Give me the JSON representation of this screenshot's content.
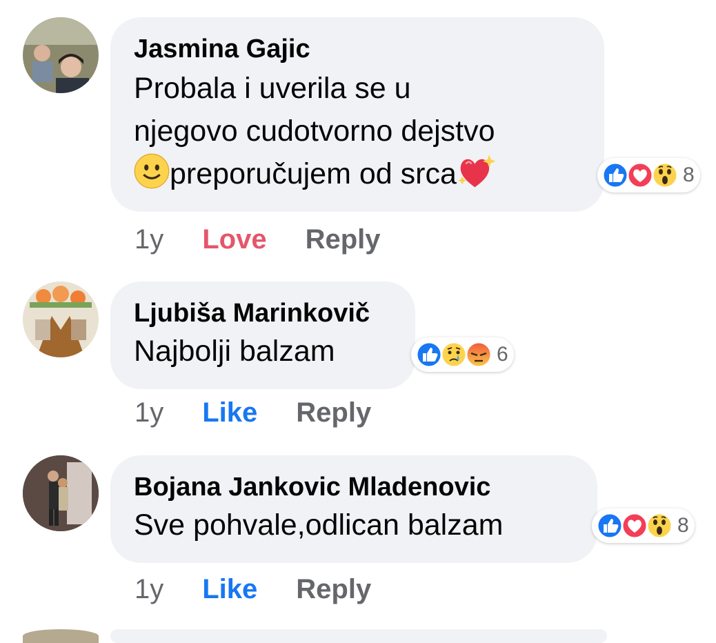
{
  "comments": [
    {
      "author": "Jasmina Gajic",
      "text_lines": [
        "Probala i uverila se u",
        "njegovo cudotvorno dejstvo",
        "preporučujem od srca"
      ],
      "reaction_count": "8",
      "reaction_icons": [
        "like-icon",
        "heart-icon",
        "wow-icon"
      ],
      "time": "1y",
      "react_label": "Love",
      "reply_label": "Reply"
    },
    {
      "author": "Ljubiša Marinkovič",
      "text": "Najbolji balzam",
      "reaction_count": "6",
      "reaction_icons": [
        "like-icon",
        "sad-icon",
        "angry-icon"
      ],
      "time": "1y",
      "react_label": "Like",
      "reply_label": "Reply"
    },
    {
      "author": "Bojana Jankovic Mladenovic",
      "text": "Sve pohvale,odlican balzam",
      "reaction_count": "8",
      "reaction_icons": [
        "like-icon",
        "heart-icon",
        "wow-icon"
      ],
      "time": "1y",
      "react_label": "Like",
      "reply_label": "Reply"
    }
  ],
  "colors": {
    "bubble": "#f0f2f5",
    "love_active": "#e4566c",
    "like_blue": "#1877f2",
    "meta_gray": "#65676b"
  }
}
